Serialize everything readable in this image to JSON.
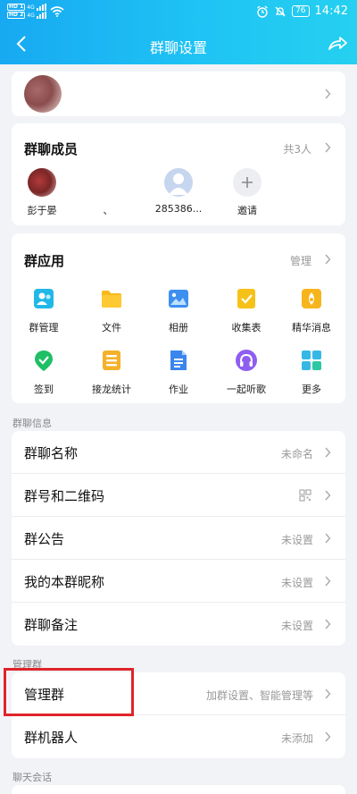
{
  "status_bar": {
    "sim1": "HD 1",
    "sim2": "HD 2",
    "net1": "4G",
    "net2": "4G",
    "battery": "76",
    "time": "14:42"
  },
  "header": {
    "title": "群聊设置"
  },
  "members": {
    "title": "群聊成员",
    "count": "共3人",
    "list": [
      {
        "name": "彭于晏"
      },
      {
        "name": "、"
      },
      {
        "name": "285386..."
      }
    ],
    "invite": "邀请"
  },
  "apps": {
    "title": "群应用",
    "manage": "管理",
    "items": [
      {
        "label": "群管理",
        "icon": "group-manage-icon"
      },
      {
        "label": "文件",
        "icon": "folder-icon"
      },
      {
        "label": "相册",
        "icon": "album-icon"
      },
      {
        "label": "收集表",
        "icon": "form-icon"
      },
      {
        "label": "精华消息",
        "icon": "essence-icon"
      },
      {
        "label": "签到",
        "icon": "checkin-icon"
      },
      {
        "label": "接龙统计",
        "icon": "relay-icon"
      },
      {
        "label": "作业",
        "icon": "homework-icon"
      },
      {
        "label": "一起听歌",
        "icon": "music-icon"
      },
      {
        "label": "更多",
        "icon": "more-icon"
      }
    ]
  },
  "info": {
    "section": "群聊信息",
    "rows": [
      {
        "label": "群聊名称",
        "value": "未命名"
      },
      {
        "label": "群号和二维码",
        "value": ""
      },
      {
        "label": "群公告",
        "value": "未设置"
      },
      {
        "label": "我的本群昵称",
        "value": "未设置"
      },
      {
        "label": "群聊备注",
        "value": "未设置"
      }
    ]
  },
  "admin": {
    "section": "管理群",
    "rows": [
      {
        "label": "管理群",
        "value": "加群设置、智能管理等"
      },
      {
        "label": "群机器人",
        "value": "未添加"
      }
    ]
  },
  "chat": {
    "section": "聊天会话"
  },
  "colors": {
    "header_start": "#17a9f2",
    "header_end": "#25d0f0",
    "highlight": "#e0242a"
  }
}
